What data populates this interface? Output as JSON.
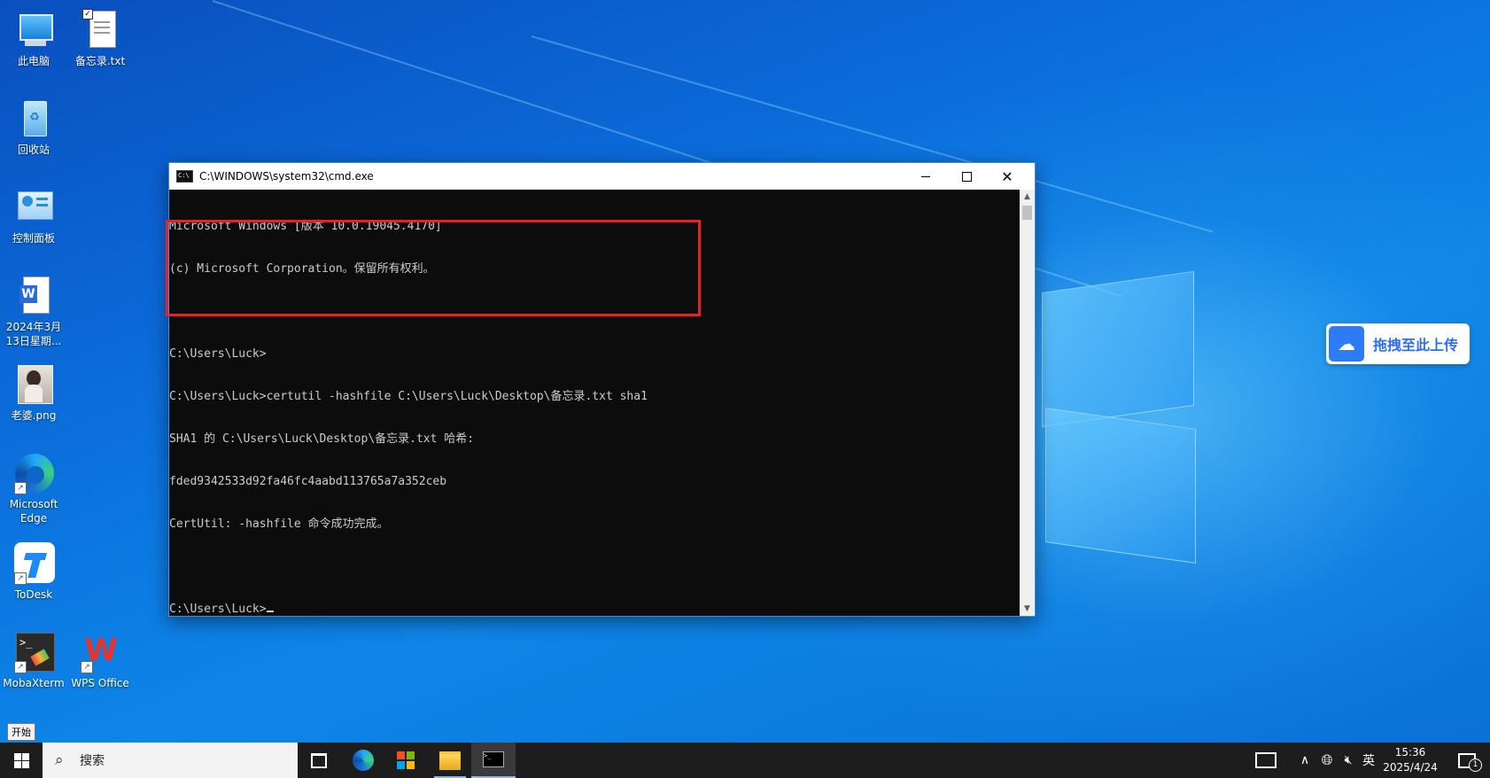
{
  "desktop": {
    "icons": [
      {
        "label": "此电脑"
      },
      {
        "label": "备忘录.txt"
      },
      {
        "label": "回收站"
      },
      {
        "label": "控制面板"
      },
      {
        "label": "2024年3月13日星期..."
      },
      {
        "label": "老婆.png"
      },
      {
        "label": "Microsoft Edge"
      },
      {
        "label": "ToDesk"
      },
      {
        "label": "MobaXterm"
      },
      {
        "label": "WPS Office"
      }
    ]
  },
  "cmd_window": {
    "title": "C:\\WINDOWS\\system32\\cmd.exe",
    "icon_text": "C:\\",
    "lines": [
      "Microsoft Windows [版本 10.0.19045.4170]",
      "(c) Microsoft Corporation。保留所有权利。",
      "",
      "C:\\Users\\Luck>",
      "C:\\Users\\Luck>certutil -hashfile C:\\Users\\Luck\\Desktop\\备忘录.txt sha1",
      "SHA1 的 C:\\Users\\Luck\\Desktop\\备忘录.txt 哈希:",
      "fded9342533d92fa46fc4aabd113765a7a352ceb",
      "CertUtil: -hashfile 命令成功完成。",
      ""
    ],
    "prompt": "C:\\Users\\Luck>"
  },
  "upload_widget": {
    "label": "拖拽至此上传"
  },
  "start_tooltip": "开始",
  "taskbar": {
    "search_placeholder": "搜索",
    "input_method": "英",
    "time": "15:36",
    "date": "2025/4/24",
    "notification_count": "1"
  },
  "colors": {
    "highlight_border": "#e8202a",
    "console_bg": "#0c0c0c",
    "console_text": "#cccccc",
    "taskbar_bg": "#1d1d1d",
    "upload_accent": "#2d6ef0"
  }
}
